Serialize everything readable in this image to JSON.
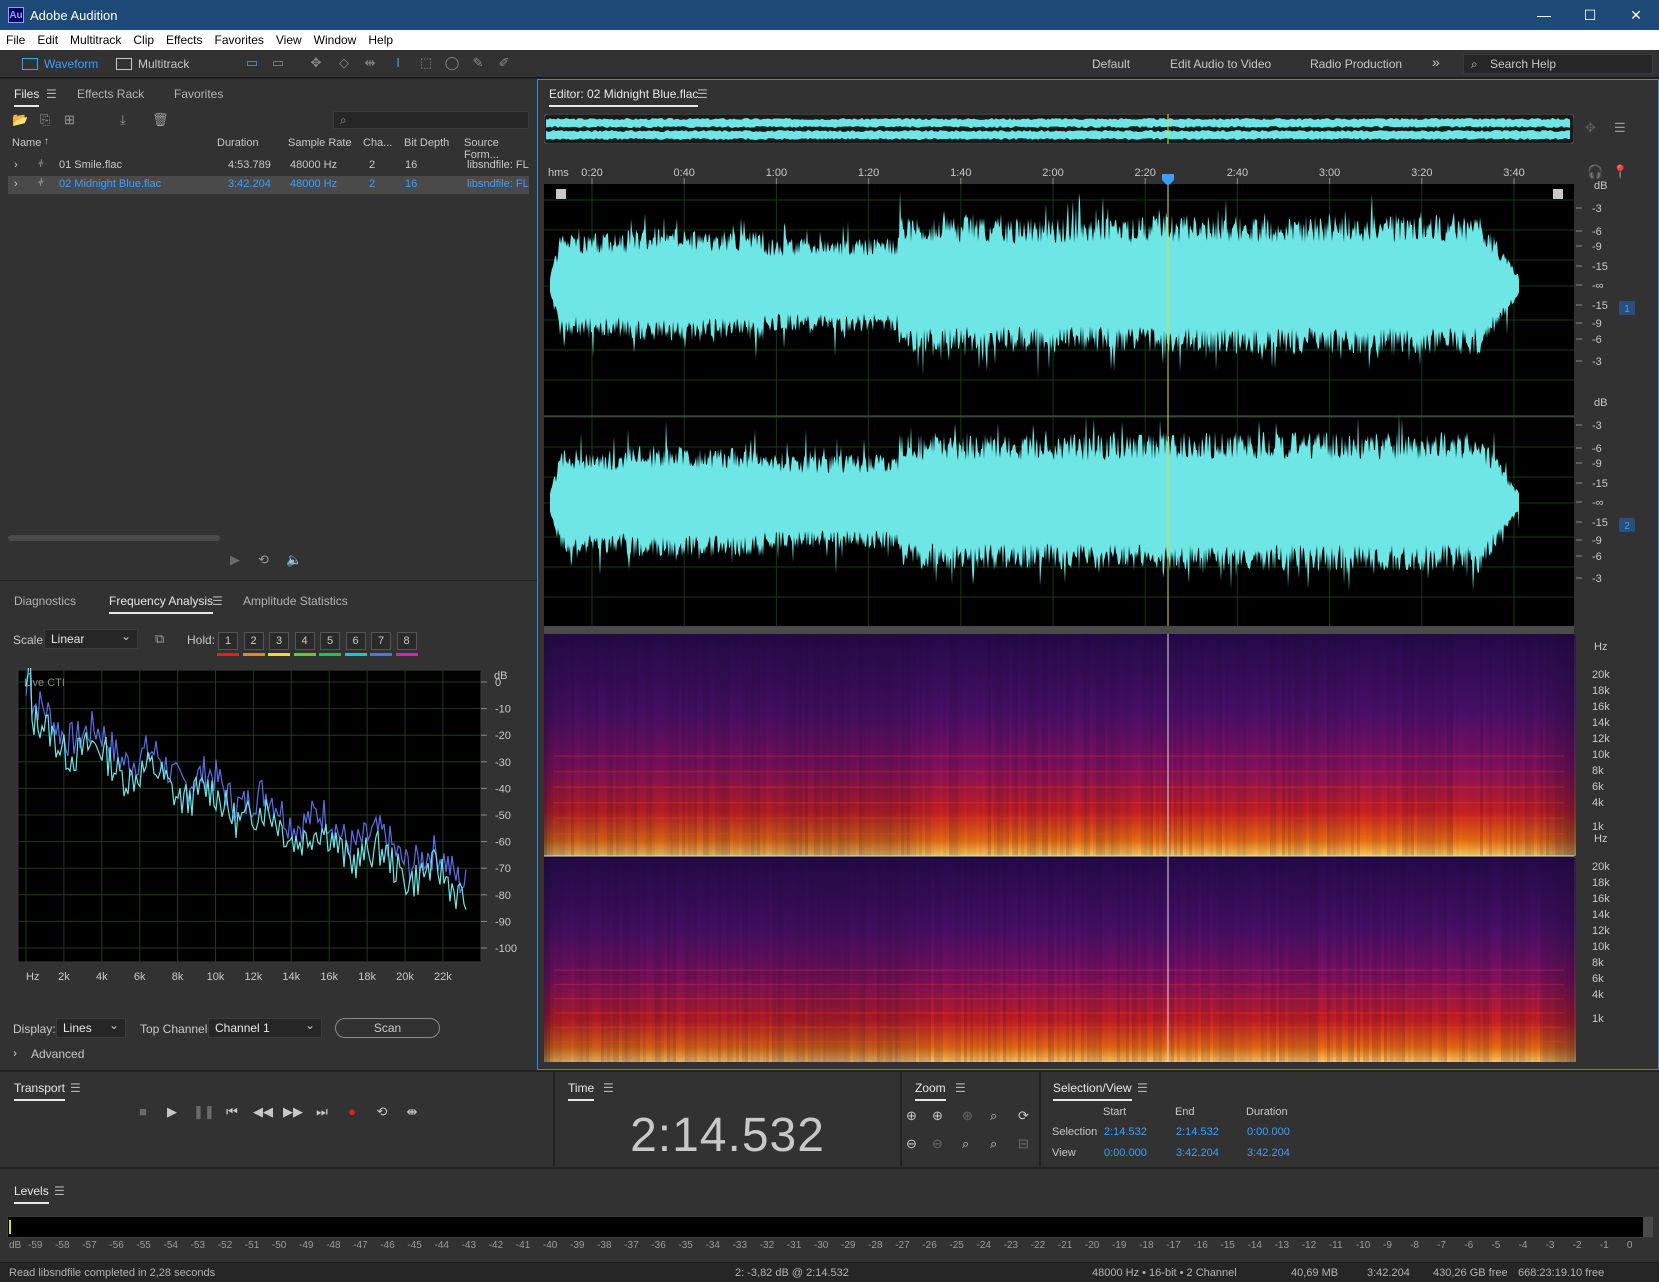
{
  "window": {
    "title": "Adobe Audition",
    "logo": "Au"
  },
  "menu": [
    "File",
    "Edit",
    "Multitrack",
    "Clip",
    "Effects",
    "Favorites",
    "View",
    "Window",
    "Help"
  ],
  "toolbar": {
    "waveform": "Waveform",
    "multitrack": "Multitrack",
    "workspaces": [
      "Default",
      "Edit Audio to Video",
      "Radio Production"
    ],
    "more": "»",
    "search_placeholder": "Search Help"
  },
  "files_panel": {
    "tabs": [
      "Files",
      "Effects Rack",
      "Favorites"
    ],
    "columns": [
      "Name",
      "Duration",
      "Sample Rate",
      "Cha...",
      "Bit Depth",
      "Source Form..."
    ],
    "rows": [
      {
        "name": "01 Smile.flac",
        "duration": "4:53.789",
        "rate": "48000 Hz",
        "channels": "2",
        "bits": "16",
        "format": "libsndfile: FL"
      },
      {
        "name": "02 Midnight Blue.flac",
        "duration": "3:42.204",
        "rate": "48000 Hz",
        "channels": "2",
        "bits": "16",
        "format": "libsndfile: FL"
      }
    ]
  },
  "analysis_panel": {
    "tabs": [
      "Diagnostics",
      "Frequency Analysis",
      "Amplitude Statistics"
    ],
    "scale_label": "Scale:",
    "scale_value": "Linear",
    "hold_label": "Hold:",
    "hold_buttons": [
      "1",
      "2",
      "3",
      "4",
      "5",
      "6",
      "7",
      "8"
    ],
    "hold_colors": [
      "#e02020",
      "#f08020",
      "#e8e020",
      "#60d020",
      "#20c060",
      "#20c0e0",
      "#3080f0",
      "#d020d0"
    ],
    "live_label": "Live CTI",
    "db_label": "dB",
    "db_ticks": [
      "0",
      "-10",
      "-20",
      "-30",
      "-40",
      "-50",
      "-60",
      "-70",
      "-80",
      "-90",
      "-100"
    ],
    "hz_ticks": [
      "Hz",
      "2k",
      "4k",
      "6k",
      "8k",
      "10k",
      "12k",
      "14k",
      "16k",
      "18k",
      "20k",
      "22k"
    ],
    "display_label": "Display:",
    "display_value": "Lines",
    "top_channel_label": "Top Channel:",
    "top_channel_value": "Channel 1",
    "scan_label": "Scan",
    "advanced_label": "Advanced"
  },
  "editor": {
    "title": "Editor: 02 Midnight Blue.flac",
    "ruler": [
      "hms",
      "0:20",
      "0:40",
      "1:00",
      "1:20",
      "1:40",
      "2:00",
      "2:20",
      "2:40",
      "3:00",
      "3:20",
      "3:40"
    ],
    "db_label": "dB",
    "db_scale": [
      "-3",
      "-6",
      "-9",
      "-15",
      "-∞",
      "-15",
      "-9",
      "-6",
      "-3"
    ],
    "channel_badges": [
      "1",
      "2"
    ],
    "hz_label": "Hz",
    "hz_scale": [
      "20k",
      "18k",
      "16k",
      "14k",
      "12k",
      "10k",
      "8k",
      "6k",
      "4k",
      "1k"
    ],
    "wave_color": "#6ee6e6",
    "playhead_color": "#e0e020"
  },
  "transport": {
    "title": "Transport"
  },
  "time": {
    "title": "Time",
    "value": "2:14.532"
  },
  "zoom": {
    "title": "Zoom"
  },
  "selection": {
    "title": "Selection/View",
    "headers": [
      "Start",
      "End",
      "Duration"
    ],
    "rows": [
      {
        "label": "Selection",
        "start": "2:14.532",
        "end": "2:14.532",
        "duration": "0:00.000"
      },
      {
        "label": "View",
        "start": "0:00.000",
        "end": "3:42.204",
        "duration": "3:42.204"
      }
    ]
  },
  "levels": {
    "title": "Levels",
    "scale": [
      "dB",
      "-59",
      "-58",
      "-57",
      "-56",
      "-55",
      "-54",
      "-53",
      "-52",
      "-51",
      "-50",
      "-49",
      "-48",
      "-47",
      "-46",
      "-45",
      "-44",
      "-43",
      "-42",
      "-41",
      "-40",
      "-39",
      "-38",
      "-37",
      "-36",
      "-35",
      "-34",
      "-33",
      "-32",
      "-31",
      "-30",
      "-29",
      "-28",
      "-27",
      "-26",
      "-25",
      "-24",
      "-23",
      "-22",
      "-21",
      "-20",
      "-19",
      "-18",
      "-17",
      "-16",
      "-15",
      "-14",
      "-13",
      "-12",
      "-11",
      "-10",
      "-9",
      "-8",
      "-7",
      "-6",
      "-5",
      "-4",
      "-3",
      "-2",
      "-1",
      "0"
    ]
  },
  "status": {
    "message": "Read libsndfile completed in 2,28 seconds",
    "cursor": "2: -3,82 dB @ 2:14.532",
    "format": "48000 Hz • 16-bit • 2 Channel",
    "size": "40,69 MB",
    "duration": "3:42.204",
    "free": "430,26 GB free",
    "free_time": "668:23:19.10 free"
  }
}
